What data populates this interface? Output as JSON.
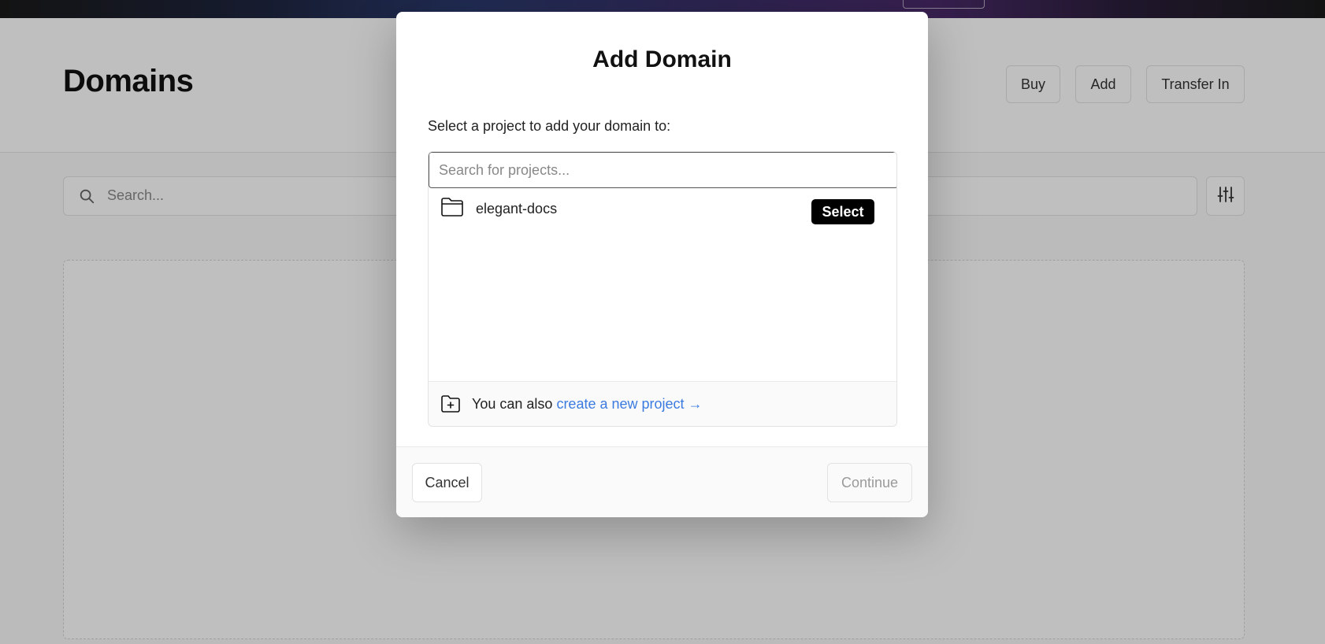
{
  "page": {
    "title": "Domains",
    "header_buttons": {
      "buy": "Buy",
      "add": "Add",
      "transfer_in": "Transfer In"
    },
    "search": {
      "placeholder": "Search..."
    }
  },
  "icons": {
    "search": "search-icon",
    "filter": "sliders-icon",
    "folder": "folder-icon",
    "new_folder": "folder-plus-icon"
  },
  "modal": {
    "title": "Add Domain",
    "description": "Select a project to add your domain to:",
    "project_search": {
      "placeholder": "Search for projects..."
    },
    "projects": [
      {
        "name": "elegant-docs",
        "action": "Select"
      }
    ],
    "create": {
      "prefix": "You can also",
      "link": "create a new project →"
    },
    "footer": {
      "cancel": "Cancel",
      "continue": "Continue"
    }
  },
  "colors": {
    "link": "#3b7be0",
    "select_button_bg": "#000000",
    "overlay": "rgba(0,0,0,0.25)"
  }
}
